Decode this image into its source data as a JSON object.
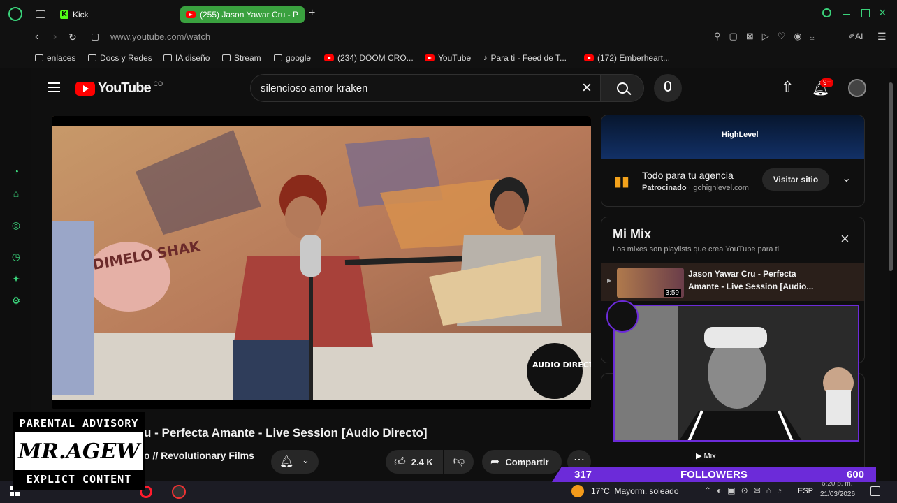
{
  "browser": {
    "tabs": [
      {
        "label": "Kick",
        "active": false
      },
      {
        "label": "(255) Jason Yawar Cru - P",
        "active": true
      }
    ],
    "url": "www.youtube.com/watch",
    "accent": "#3ad27a",
    "ai_label": "AI"
  },
  "bookmarks": [
    {
      "label": "enlaces",
      "icon": "folder-icon"
    },
    {
      "label": "Docs y Redes",
      "icon": "folder-icon"
    },
    {
      "label": "IA diseño",
      "icon": "folder-icon"
    },
    {
      "label": "Stream",
      "icon": "folder-icon"
    },
    {
      "label": "google",
      "icon": "folder-icon"
    },
    {
      "label": "(234) DOOM CRO...",
      "icon": "youtube-icon"
    },
    {
      "label": "YouTube",
      "icon": "youtube-icon"
    },
    {
      "label": "Para ti - Feed de T...",
      "icon": "tiktok-icon"
    },
    {
      "label": "(172) Emberheart...",
      "icon": "youtube-icon"
    }
  ],
  "youtube": {
    "logo_text": "YouTube",
    "country_code": "CO",
    "search_value": "silencioso amor kraken",
    "notif_count": "9+"
  },
  "video": {
    "title": "u - Perfecta Amante - Live Session [Audio Directo]",
    "channel": "o // Revolutionary Films",
    "likes": "2.4 K",
    "share_label": "Compartir",
    "watermark": "AUDIO DIRECTO",
    "wall_text": "DIMELO SHAK"
  },
  "ad": {
    "brand": "HighLevel",
    "title": "Todo para tu agencia",
    "sponsored": "Patrocinado",
    "domain": "gohighlevel.com",
    "cta": "Visitar sitio"
  },
  "mix": {
    "title": "Mi Mix",
    "subtitle": "Los mixes son playlists que crea YouTube para ti",
    "item_title": "Jason Yawar Cru - Perfecta Amante - Live Session [Audio...",
    "item_duration": "3:59",
    "badge": "Mix"
  },
  "stream_overlay": {
    "followers_current": "317",
    "followers_label": "FOLLOWERS",
    "followers_goal": "600",
    "advisory_top": "PARENTAL ADVISORY",
    "advisory_logo": "MR.AGEW",
    "advisory_bottom": "EXPLICT CONTENT"
  },
  "taskbar": {
    "weather": "17°C  Mayorm. soleado",
    "lang": "ESP",
    "time": "6:20 p. m.",
    "date": "21/03/2026"
  }
}
